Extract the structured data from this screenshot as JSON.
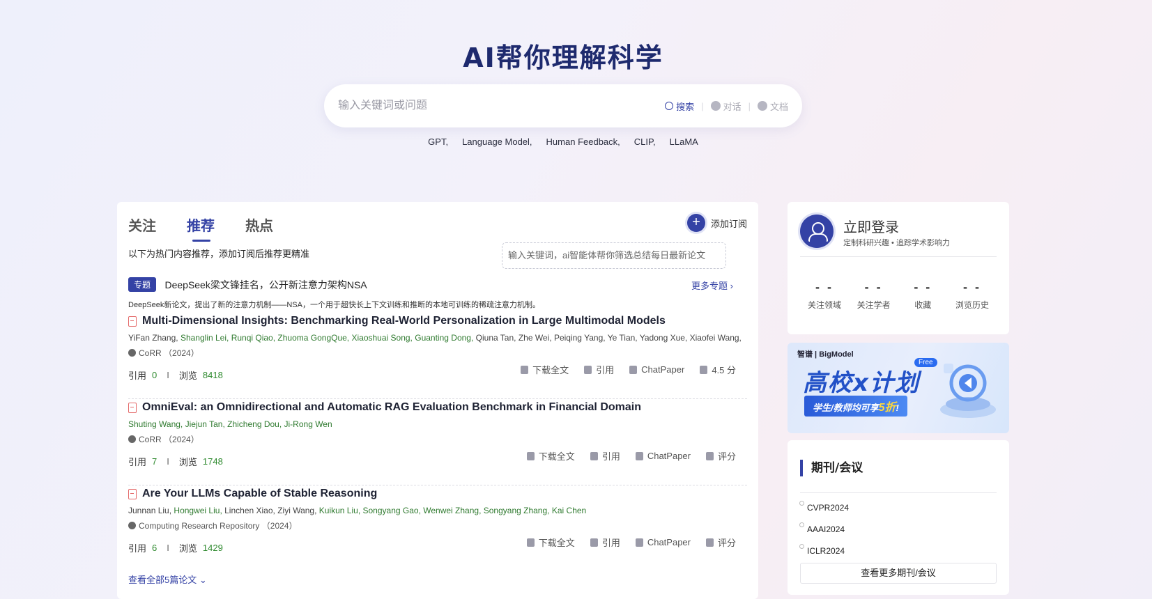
{
  "hero": {
    "title": "AI帮你理解科学",
    "search_placeholder": "输入关键词或问题",
    "modes": [
      "搜索",
      "对话",
      "文档"
    ],
    "tags": [
      "GPT,",
      "Language Model,",
      "Human Feedback,",
      "CLIP,",
      "LLaMA"
    ]
  },
  "feed": {
    "tabs": [
      "关注",
      "推荐",
      "热点"
    ],
    "active_tab": "推荐",
    "subscribe_label": "添加订阅",
    "hint": "以下为热门内容推荐，添加订阅后推荐更精准",
    "tooltip": "输入关键词，ai智能体帮你筛选总结每日最新论文",
    "topic": {
      "badge": "专题",
      "title": "DeepSeek梁文锋挂名，公开新注意力架构NSA",
      "more": "更多专题",
      "desc": "DeepSeek新论文，提出了新的注意力机制——NSA，一个用于超快长上下文训练和推断的本地可训练的稀疏注意力机制。"
    },
    "papers": [
      {
        "title": "Multi-Dimensional Insights: Benchmarking Real-World Personalization in Large Multimodal Models",
        "authors": [
          {
            "name": "YiFan Zhang,",
            "hl": false
          },
          {
            "name": "Shanglin Lei,",
            "hl": true
          },
          {
            "name": "Runqi Qiao,",
            "hl": true
          },
          {
            "name": "Zhuoma GongQue,",
            "hl": true
          },
          {
            "name": "Xiaoshuai Song,",
            "hl": true
          },
          {
            "name": "Guanting Dong,",
            "hl": true
          },
          {
            "name": "Qiuna Tan,",
            "hl": false
          },
          {
            "name": "Zhe Wei,",
            "hl": false
          },
          {
            "name": "Peiqing Yang,",
            "hl": false
          },
          {
            "name": "Ye Tian,",
            "hl": false
          },
          {
            "name": "Yadong Xue,",
            "hl": false
          },
          {
            "name": "Xiaofei Wang,",
            "hl": false
          }
        ],
        "venue": "CoRR",
        "year": "（2024）",
        "cite_label": "引用",
        "cite_count": "0",
        "view_label": "浏览",
        "view_count": "8418",
        "actions": [
          "下载全文",
          "引用",
          "ChatPaper",
          "4.5 分"
        ]
      },
      {
        "title": "OmniEval: an Omnidirectional and Automatic RAG Evaluation Benchmark in Financial Domain",
        "authors": [
          {
            "name": "Shuting Wang,",
            "hl": true
          },
          {
            "name": "Jiejun Tan,",
            "hl": true
          },
          {
            "name": "Zhicheng Dou,",
            "hl": true
          },
          {
            "name": "Ji-Rong Wen",
            "hl": true
          }
        ],
        "venue": "CoRR",
        "year": "（2024）",
        "cite_label": "引用",
        "cite_count": "7",
        "view_label": "浏览",
        "view_count": "1748",
        "actions": [
          "下载全文",
          "引用",
          "ChatPaper",
          "评分"
        ]
      },
      {
        "title": "Are Your LLMs Capable of Stable Reasoning",
        "authors": [
          {
            "name": "Junnan Liu,",
            "hl": false
          },
          {
            "name": "Hongwei Liu,",
            "hl": true
          },
          {
            "name": "Linchen Xiao,",
            "hl": false
          },
          {
            "name": "Ziyi Wang,",
            "hl": false
          },
          {
            "name": "Kuikun Liu,",
            "hl": true
          },
          {
            "name": "Songyang Gao,",
            "hl": true
          },
          {
            "name": "Wenwei Zhang,",
            "hl": true
          },
          {
            "name": "Songyang Zhang,",
            "hl": true
          },
          {
            "name": "Kai Chen",
            "hl": true
          }
        ],
        "venue": "Computing Research Repository",
        "year": "（2024）",
        "cite_label": "引用",
        "cite_count": "6",
        "view_label": "浏览",
        "view_count": "1429",
        "actions": [
          "下载全文",
          "引用",
          "ChatPaper",
          "评分"
        ]
      }
    ],
    "view_all": "查看全部5篇论文"
  },
  "user": {
    "login": "立即登录",
    "login_sub": "定制科研兴趣 • 追踪学术影响力",
    "counts": [
      {
        "value": "- -",
        "label": "关注领域"
      },
      {
        "value": "- -",
        "label": "关注学者"
      },
      {
        "value": "- -",
        "label": "收藏"
      },
      {
        "value": "- -",
        "label": "浏览历史"
      }
    ]
  },
  "banner": {
    "logo": "智谱 | BigModel",
    "main": "高校x计划",
    "free": "Free",
    "sub_prefix": "学生/教师均可享",
    "sub_highlight": "5折",
    "sub_suffix": "!"
  },
  "journals": {
    "title": "期刊/会议",
    "items": [
      "CVPR2024",
      "AAAI2024",
      "ICLR2024"
    ],
    "more": "查看更多期刊/会议"
  },
  "colors": {
    "accent": "#3442a5",
    "author_highlight": "#2f7a2f",
    "count": "#2f8a2f"
  }
}
